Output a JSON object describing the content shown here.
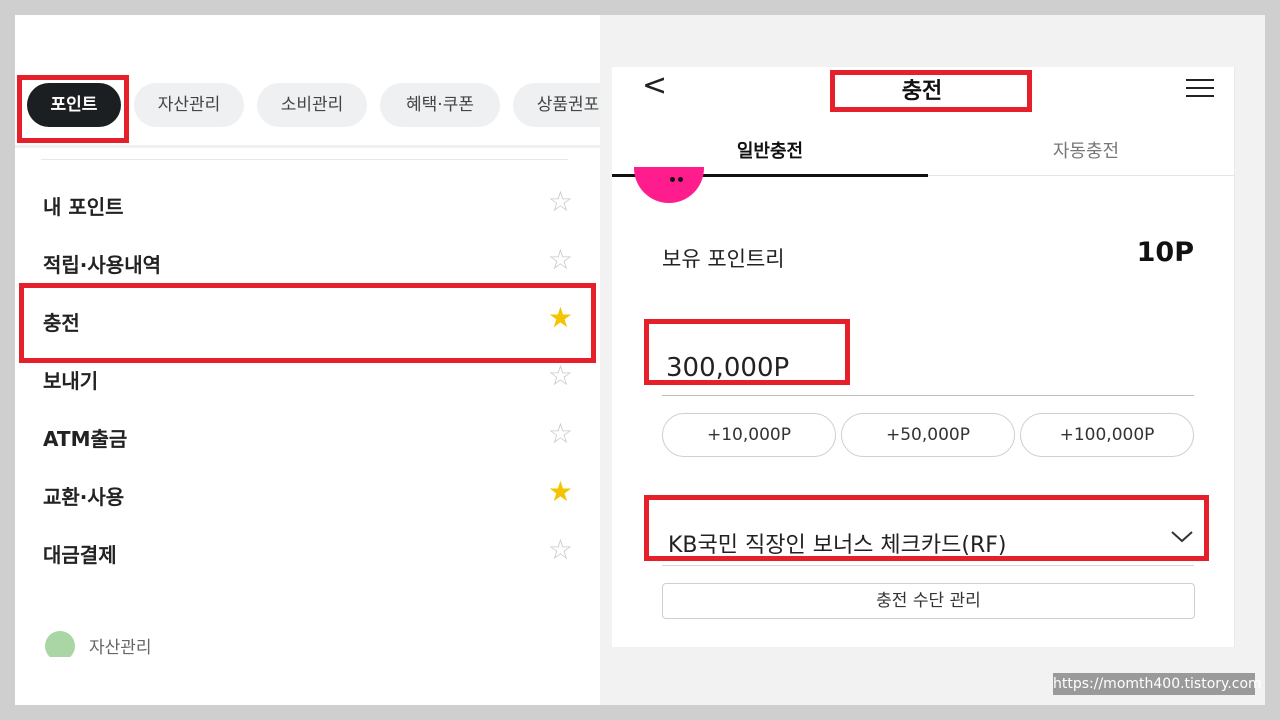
{
  "left": {
    "chips": [
      {
        "label": "포인트",
        "active": true
      },
      {
        "label": "자산관리",
        "active": false
      },
      {
        "label": "소비관리",
        "active": false
      },
      {
        "label": "혜택·쿠폰",
        "active": false
      },
      {
        "label": "상품권포",
        "active": false
      }
    ],
    "menu": [
      {
        "label": "내 포인트",
        "starred": false
      },
      {
        "label": "적립·사용내역",
        "starred": false
      },
      {
        "label": "충전",
        "starred": true
      },
      {
        "label": "보내기",
        "starred": false
      },
      {
        "label": "ATM출금",
        "starred": false
      },
      {
        "label": "교환·사용",
        "starred": true
      },
      {
        "label": "대금결제",
        "starred": false
      }
    ],
    "next_section_label": "자산관리"
  },
  "right": {
    "back_glyph": "<",
    "title": "충전",
    "tabs": [
      {
        "label": "일반충전",
        "active": true
      },
      {
        "label": "자동충전",
        "active": false
      }
    ],
    "balance_label": "보유 포인트리",
    "balance_value": "10P",
    "amount_value": "300,000P",
    "quick_add": [
      "+10,000P",
      "+50,000P",
      "+100,000P"
    ],
    "selected_card": "KB국민 직장인 보너스 체크카드(RF)",
    "manage_button": "충전 수단 관리"
  },
  "watermark": "https://momth400.tistory.com",
  "colors": {
    "highlight": "#e5202a",
    "active_chip": "#1c1f22",
    "star_on": "#f5c400",
    "star_off": "#c8c8c8",
    "mascot": "#ff1d8e"
  },
  "icons": {
    "back": "chevron-left-icon",
    "menu": "hamburger-menu-icon",
    "dropdown": "chevron-down-icon",
    "favorite": "star-icon"
  }
}
